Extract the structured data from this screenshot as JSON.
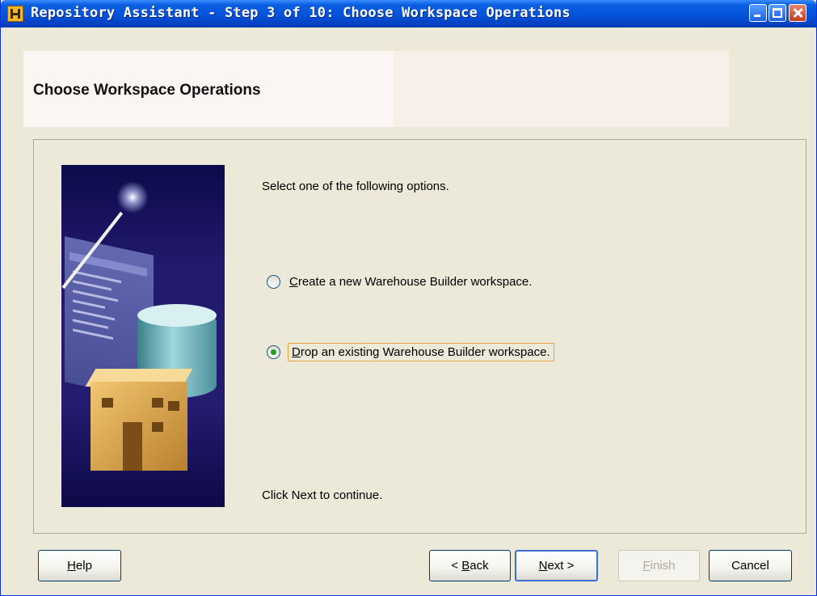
{
  "window": {
    "title": "Repository Assistant - Step 3 of 10: Choose Workspace Operations"
  },
  "header": {
    "title": "Choose Workspace Operations"
  },
  "main": {
    "instruction": "Select one of the following options.",
    "options": [
      {
        "mnemonic": "C",
        "rest": "reate a new Warehouse Builder workspace.",
        "selected": false
      },
      {
        "mnemonic": "D",
        "rest": "rop an existing Warehouse Builder workspace.",
        "selected": true
      }
    ],
    "continue_text": "Click Next to continue."
  },
  "buttons": {
    "help": {
      "mnemonic": "H",
      "rest": "elp"
    },
    "back": {
      "prefix": "< ",
      "mnemonic": "B",
      "rest": "ack"
    },
    "next": {
      "mnemonic": "N",
      "rest": "ext >"
    },
    "finish": {
      "mnemonic": "F",
      "rest": "inish",
      "enabled": false
    },
    "cancel": {
      "label": "Cancel"
    }
  },
  "colors": {
    "title_bar": "#0555dc",
    "focus_border": "#e8a33c",
    "radio_selected_dot": "#21a121"
  }
}
